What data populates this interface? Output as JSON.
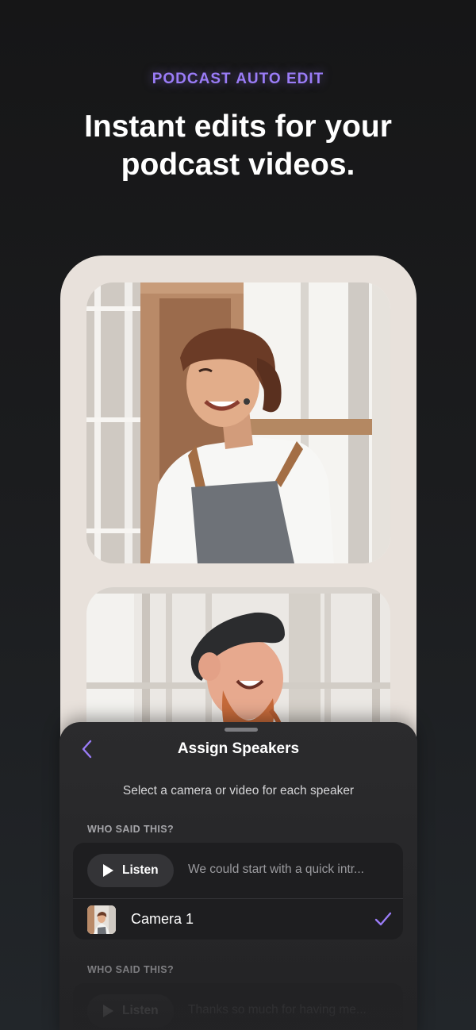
{
  "header": {
    "eyebrow": "PODCAST AUTO EDIT",
    "headline_line1": "Instant edits for your",
    "headline_line2": "podcast videos."
  },
  "sheet": {
    "title": "Assign Speakers",
    "subtitle": "Select a camera or video for each speaker",
    "back_icon": "chevron-left-icon",
    "accent_color": "#9a7cf7",
    "sections": [
      {
        "label": "WHO SAID THIS?",
        "listen_label": "Listen",
        "quote": "We could start with a quick intr...",
        "camera_label": "Camera 1",
        "selected": true
      },
      {
        "label": "WHO SAID THIS?",
        "listen_label": "Listen",
        "quote": "Thanks so much for having me..."
      }
    ]
  }
}
